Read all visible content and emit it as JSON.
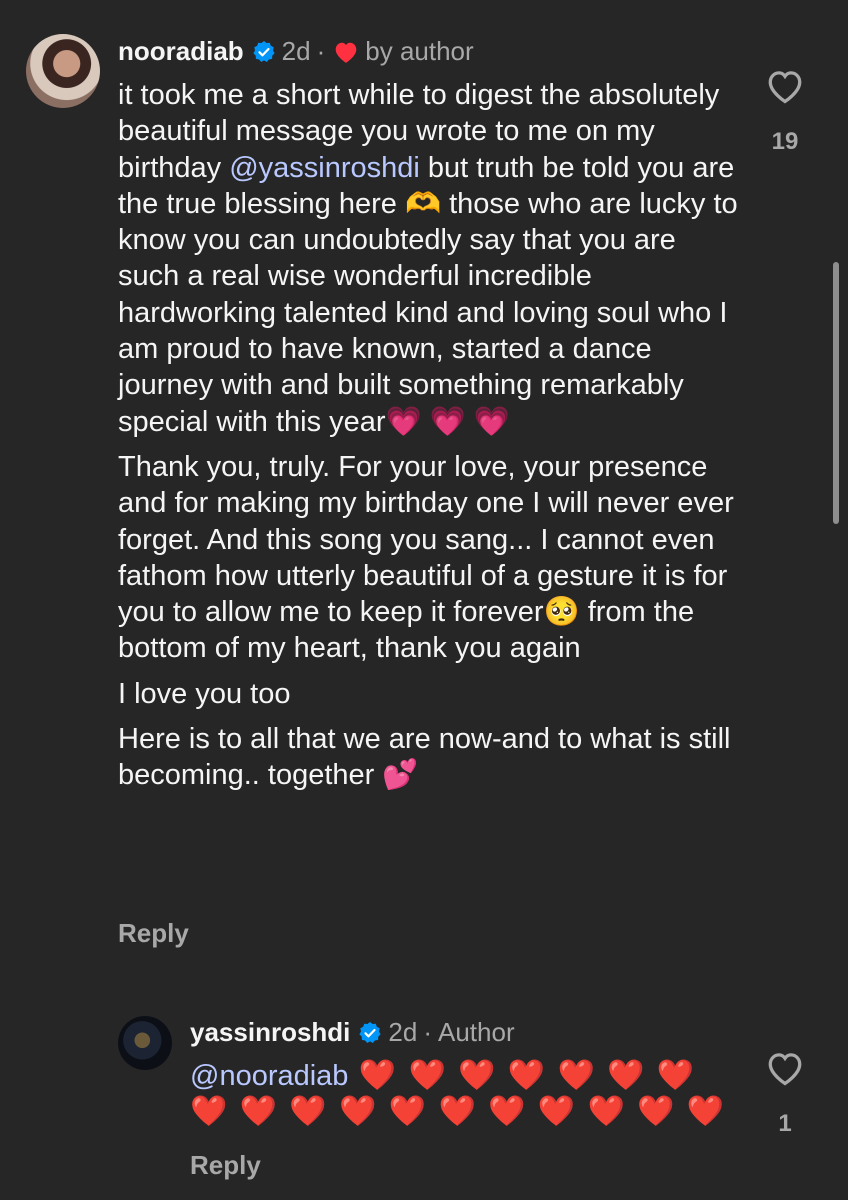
{
  "comment": {
    "username": "nooradiab",
    "time": "2d",
    "separator": "·",
    "liked_by": "by author",
    "paragraphs": [
      [
        "it took me a short while to digest the absolutely beautiful message you wrote to me on my birthday ",
        "@yassinroshdi",
        " but truth be told you are the true blessing here 🫶 those who are lucky to know you can undoubtedly say that you are such a real wise wonderful incredible hardworking talented kind and loving soul who I am proud to have known, started a dance journey with and built something remarkably special with this year💗 💗 💗"
      ],
      [
        "Thank you, truly. For your love, your presence and for making my birthday one I will never ever forget. And this song you sang... I cannot even fathom how utterly beautiful of a gesture it is for you to allow me to keep it forever🥺 from the bottom of my heart, thank you again"
      ],
      [
        "I love you too"
      ],
      [
        "Here is to all that we are now-and to what is still becoming.. together 💕"
      ]
    ],
    "reply_label": "Reply",
    "likes": "19"
  },
  "reply": {
    "username": "yassinroshdi",
    "time": "2d",
    "separator": "·",
    "badge": "Author",
    "mention": "@nooradiab",
    "hearts_line1": " ❤️ ❤️ ❤️ ❤️ ❤️ ❤️ ❤️",
    "hearts_line2": "❤️ ❤️ ❤️ ❤️ ❤️ ❤️ ❤️ ❤️ ❤️ ❤️ ❤️",
    "reply_label": "Reply",
    "likes": "1"
  },
  "colors": {
    "background": "#262626",
    "text": "#f5f5f5",
    "muted": "#a8a8a8",
    "mention": "#b9c8ff",
    "verified": "#0095f6",
    "heart": "#ff3040"
  }
}
